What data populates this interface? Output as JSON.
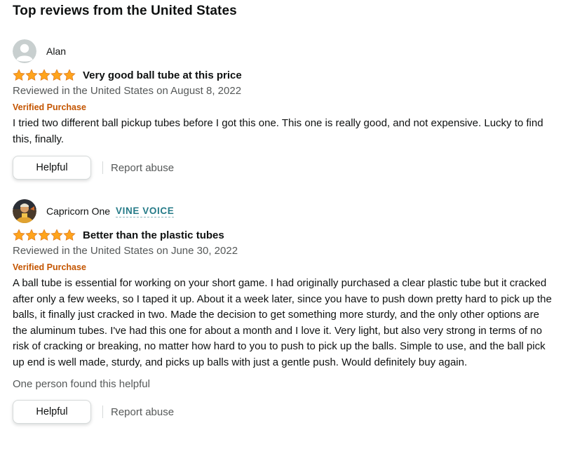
{
  "section": {
    "title": "Top reviews from the United States"
  },
  "colors": {
    "star": "#ffa41c",
    "verified": "#c45500",
    "vine": "#267b88",
    "muted": "#565959"
  },
  "reviews": [
    {
      "author": "Alan",
      "rating": 5,
      "title": "Very good ball tube at this price",
      "date": "Reviewed in the United States on August 8, 2022",
      "verified": "Verified Purchase",
      "body": "I tried two different ball pickup tubes before I got this one. This one is really good, and not expensive. Lucky to find this, finally.",
      "helpful_label": "Helpful",
      "report_label": "Report abuse"
    },
    {
      "author": "Capricorn One",
      "badge": "VINE VOICE",
      "rating": 5,
      "title": "Better than the plastic tubes",
      "date": "Reviewed in the United States on June 30, 2022",
      "verified": "Verified Purchase",
      "body": "A ball tube is essential for working on your short game. I had originally purchased a clear plastic tube but it cracked after only a few weeks, so I taped it up. About it a week later, since you have to push down pretty hard to pick up the balls, it finally just cracked in two. Made the decision to get something more sturdy, and the only other options are the aluminum tubes. I've had this one for about a month and I love it. Very light, but also very strong in terms of no risk of cracking or breaking, no matter how hard to you to push to pick up the balls. Simple to use, and the ball pick up end is well made, sturdy, and picks up balls with just a gentle push. Would definitely buy again.",
      "found_helpful": "One person found this helpful",
      "helpful_label": "Helpful",
      "report_label": "Report abuse"
    }
  ]
}
